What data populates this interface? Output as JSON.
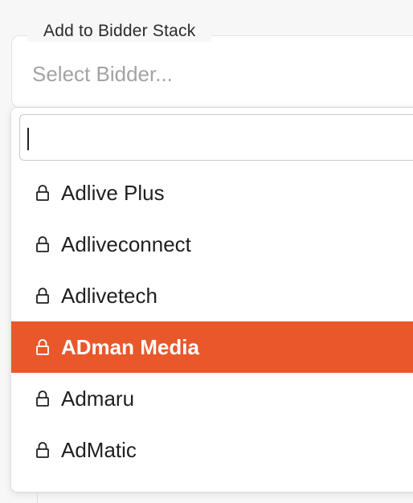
{
  "field": {
    "legend": "Add to Bidder Stack",
    "placeholder": "Select Bidder..."
  },
  "dropdown": {
    "search_value": "",
    "options": [
      {
        "label": "Adlive Plus",
        "icon": "lock-icon",
        "highlighted": false
      },
      {
        "label": "Adliveconnect",
        "icon": "lock-icon",
        "highlighted": false
      },
      {
        "label": "Adlivetech",
        "icon": "lock-icon",
        "highlighted": false
      },
      {
        "label": "ADman Media",
        "icon": "lock-icon",
        "highlighted": true
      },
      {
        "label": "Admaru",
        "icon": "lock-icon",
        "highlighted": false
      },
      {
        "label": "AdMatic",
        "icon": "lock-icon",
        "highlighted": false
      }
    ]
  },
  "colors": {
    "highlight": "#e8582b",
    "placeholder": "#a3a3a3"
  }
}
